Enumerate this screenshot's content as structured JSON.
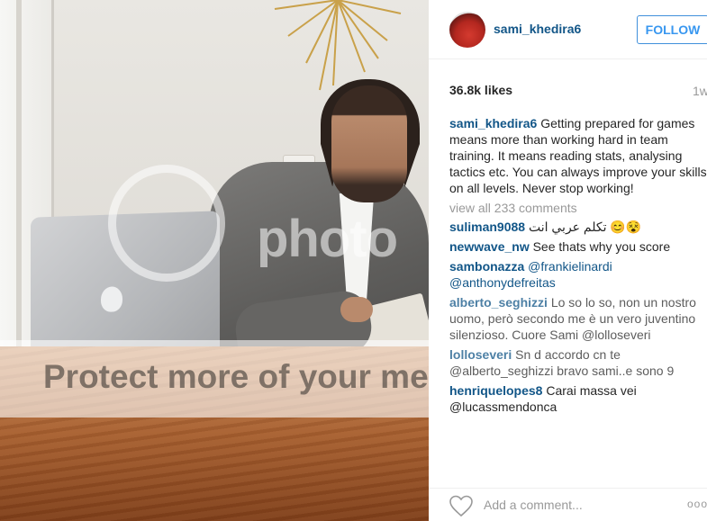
{
  "watermark": {
    "brand_text": "photo",
    "banner_text": "Protect more of your memories"
  },
  "header": {
    "username": "sami_khedira6",
    "follow_label": "FOLLOW"
  },
  "stats": {
    "likes": "36.8k likes",
    "age": "1w"
  },
  "caption": {
    "username": "sami_khedira6",
    "text": "Getting prepared for games means more than working hard in team training. It means reading stats, analysing tactics etc. You can always improve your skills on all levels. Never stop working!"
  },
  "view_all": "view all 233 comments",
  "comments": [
    {
      "username": "suliman9088",
      "text": "تكلم عربي انت 😊😵"
    },
    {
      "username": "newwave_nw",
      "text": "See thats why you score"
    },
    {
      "username": "sambonazza",
      "text": "@frankielinardi @anthonydefreitas"
    },
    {
      "username": "alberto_seghizzi",
      "text": "Lo so lo so, non un nostro uomo, però secondo me è un vero juventino silenzioso. Cuore Sami @lolloseveri"
    },
    {
      "username": "lolloseveri",
      "text": "Sn d accordo cn te @alberto_seghizzi bravo sami..e sono 9"
    },
    {
      "username": "henriquelopes8",
      "text": "Carai massa vei @lucassmendonca"
    }
  ],
  "footer": {
    "add_comment_placeholder": "Add a comment...",
    "more_label": "ooo"
  }
}
